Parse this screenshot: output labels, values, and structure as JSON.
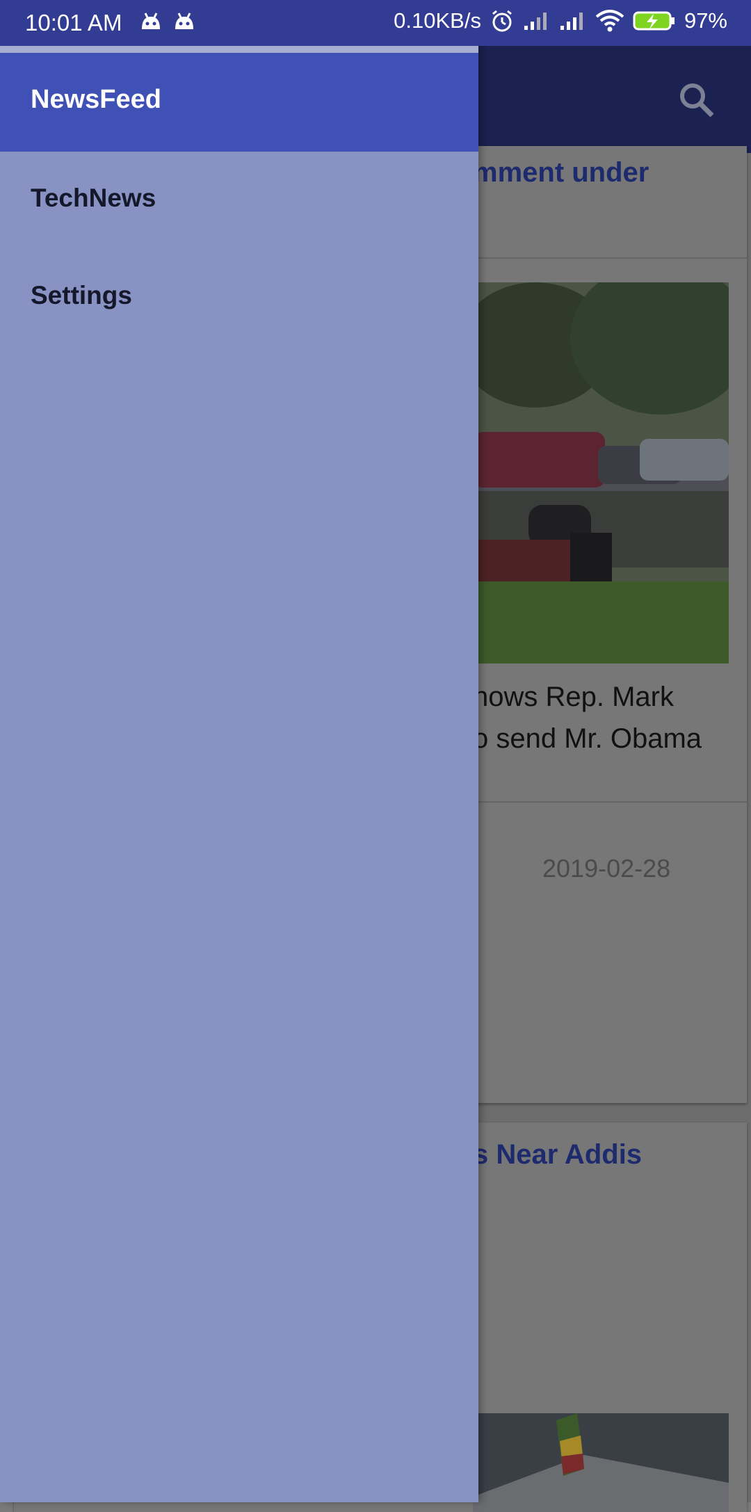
{
  "status_bar": {
    "time": "10:01 AM",
    "net_speed": "0.10KB/s",
    "battery": "97%"
  },
  "drawer": {
    "title": "NewsFeed",
    "items": [
      {
        "label": "TechNews"
      },
      {
        "label": "Settings"
      }
    ]
  },
  "background": {
    "card1": {
      "title_fragment": "mment under",
      "body_line1": "hows Rep. Mark",
      "body_line2": "o send Mr. Obama",
      "date": "2019-02-28"
    },
    "card2": {
      "title_fragment": "s Near Addis"
    }
  },
  "colors": {
    "status_bar": "#333c93",
    "drawer_header": "#3f51b5",
    "drawer_bg": "#8893c3"
  }
}
